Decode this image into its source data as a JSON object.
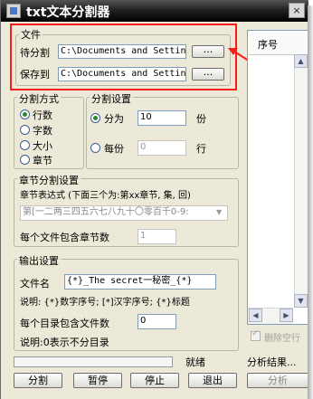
{
  "window": {
    "title": "txt文本分割器",
    "close": "×"
  },
  "file_group": {
    "title": "文件",
    "split_label": "待分割",
    "split_path": "C:\\Documents and Setting",
    "browse1": "...",
    "save_label": "保存到",
    "save_path": "C:\\Documents and Setting",
    "browse2": "..."
  },
  "split_mode": {
    "title": "分割方式",
    "options": [
      "行数",
      "字数",
      "大小",
      "章节"
    ],
    "selected": "行数"
  },
  "split_settings": {
    "title": "分割设置",
    "divide_label": "分为",
    "divide_value": "10",
    "divide_unit": "份",
    "every_label": "每份",
    "every_value": "0",
    "every_unit": "行",
    "selected": "分为"
  },
  "chapter": {
    "title": "章节分割设置",
    "expr_label": "章节表达式 (下面三个为:第xx章节, 集, 回)",
    "expr_value": "第[一二两三四五六七八九十〇零百千0-9:",
    "per_file_label": "每个文件包含章节数",
    "per_file_value": "1"
  },
  "output": {
    "title": "输出设置",
    "filename_label": "文件名",
    "filename_value": "{*}_The secret一秘密_{*}",
    "desc": "说明: {*}数字序号; [*]汉字序号; {*}标题",
    "per_dir_label": "每个目录包含文件数",
    "per_dir_value": "0",
    "note": "说明:0表示不分目录"
  },
  "status": "就绪",
  "buttons": {
    "split": "分割",
    "pause": "暂停",
    "stop": "停止",
    "exit": "退出"
  },
  "right_panel": {
    "column_header": "序号",
    "delete_empty_label": "删除空行",
    "analyze_label": "分析结果...",
    "analyze_button": "分析"
  },
  "colors": {
    "highlight": "#ff1a1a",
    "titlebar": "#000000",
    "background": "#ece9d8"
  }
}
